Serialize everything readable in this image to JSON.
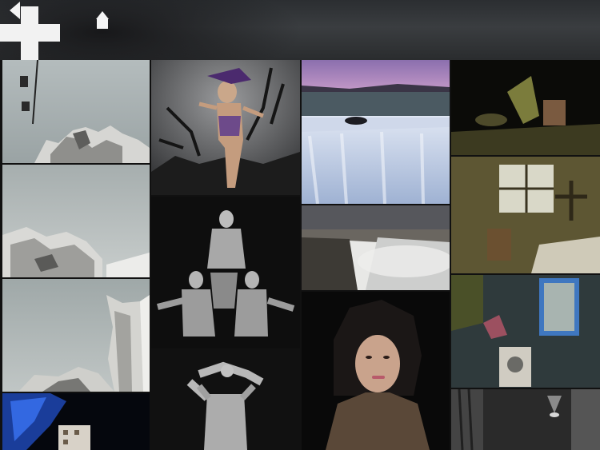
{
  "toolbar": {
    "back_icon": "back-arrow-icon",
    "add_icon": "plus-icon",
    "home_icon": "home-icon"
  },
  "gallery": {
    "columns": 4,
    "photos": [
      {
        "id": "building-steel-1",
        "subject": "gehry-building-sky"
      },
      {
        "id": "building-steel-2",
        "subject": "gehry-building-sky"
      },
      {
        "id": "building-steel-3",
        "subject": "gehry-building-sky"
      },
      {
        "id": "building-blue",
        "subject": "blue-lit-building-night"
      },
      {
        "id": "fantasy-woman",
        "subject": "woman-feather-headdress-trees"
      },
      {
        "id": "bodies-pyramid",
        "subject": "human-figure-pyramid"
      },
      {
        "id": "bodies-knot",
        "subject": "intertwined-figures"
      },
      {
        "id": "waterfall-1",
        "subject": "waterfall-pink-sky"
      },
      {
        "id": "waterfall-2",
        "subject": "waterfall-canyon-mist"
      },
      {
        "id": "portrait-woman",
        "subject": "portrait-dark-hair"
      },
      {
        "id": "still-life",
        "subject": "rustic-still-life"
      },
      {
        "id": "old-room-1",
        "subject": "abandoned-room-window"
      },
      {
        "id": "old-room-2",
        "subject": "abandoned-room-blue-window"
      },
      {
        "id": "corridor",
        "subject": "dark-corridor-lamp"
      }
    ]
  }
}
